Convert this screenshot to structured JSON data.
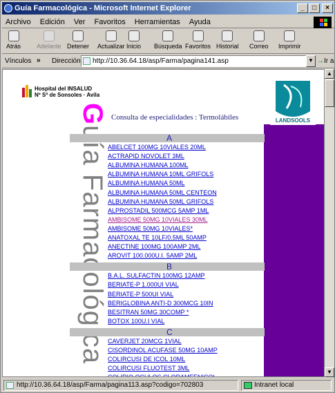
{
  "window": {
    "title": "Guía Farmacológica - Microsoft Internet Explorer",
    "min": "_",
    "max": "□",
    "close": "×"
  },
  "menu": [
    "Archivo",
    "Edición",
    "Ver",
    "Favoritos",
    "Herramientas",
    "Ayuda"
  ],
  "toolbar": [
    {
      "label": "Atrás",
      "icon": "back-arrow-icon",
      "disabled": false
    },
    {
      "label": "Adelante",
      "icon": "forward-arrow-icon",
      "disabled": true
    },
    {
      "label": "Detener",
      "icon": "stop-icon",
      "disabled": false
    },
    {
      "label": "Actualizar",
      "icon": "refresh-icon",
      "disabled": false
    },
    {
      "label": "Inicio",
      "icon": "home-icon",
      "disabled": false
    },
    {
      "label": "Búsqueda",
      "icon": "search-icon",
      "disabled": false
    },
    {
      "label": "Favoritos",
      "icon": "favorites-icon",
      "disabled": false
    },
    {
      "label": "Historial",
      "icon": "history-icon",
      "disabled": false
    },
    {
      "label": "Correo",
      "icon": "mail-icon",
      "disabled": false
    },
    {
      "label": "Imprimir",
      "icon": "print-icon",
      "disabled": false
    }
  ],
  "address": {
    "links_label": "Vínculos",
    "links_chevron": "»",
    "label": "Dirección",
    "url": "http://10.36.64.18/asp/Farma/pagina141.asp",
    "go_label": "Ir a"
  },
  "page": {
    "hospital_line1": "Hospital del INSALUD",
    "hospital_line2": "Nº Sª de Sonsoles · Avila",
    "heading": "Consulta de especialidades : Termolábiles",
    "vertical_title": "Guía Farmacológica",
    "brand": "LANDSOOLS",
    "groups": [
      {
        "letter": "A",
        "items": [
          "ABELCET 100MG 10VIALES 20ML",
          "ACTRAPID NOVOLET 3ML",
          "ALBUMINA HUMANA 100ML",
          "ALBUMINA HUMANA 10ML GRIFOLS",
          "ALBUMINA HUMANA 50ML",
          "ALBUMINA HUMANA 50ML CENTEON",
          "ALBUMINA HUMANA 50ML GRIFOLS",
          "ALPROSTADIL 500MCG 5AMP 1ML",
          "AMBISOME 50MG 10VIALES 30ML",
          "AMBISOME 50MG 10VIALES*",
          "ANATOXAL TE 10LF/0.5ML 50AMP",
          "ANECTINE 100MG 100AMP 2ML",
          "AROVIT 100.000U.I. 5AMP 2ML"
        ]
      },
      {
        "letter": "B",
        "items": [
          "B.A.L. SULFACTIN 100MG 12AMP",
          "BERIATE-P 1.000UI VIAL",
          "BERIATE-P 500UI VIAL",
          "BERIGLOBINA ANTI-D 300MCG 10IN",
          "BESITRAN 50MG 30COMP *",
          "BOTOX 100U.I VIAL"
        ]
      },
      {
        "letter": "C",
        "items": [
          "CAVERJET 20MCG 1VIAL",
          "CISORDINOL ACUFASE 50MG 10AMP",
          "COLIRCUSI DE ICOL 10ML",
          "COLIRCUSI FLUOTEST 3ML",
          "COLIRIO OCULOS CLORAMFENICOL"
        ]
      }
    ],
    "visited_item": "AMBISOME 50MG 10VIALES 30ML"
  },
  "status": {
    "url": "http://10.36.64.18/asp/Farma/pagina113.asp?codigo=702803",
    "zone": "Intranet local"
  },
  "colors": {
    "link": "#0000cc",
    "visited": "#a0208f",
    "sidebar": "#660099",
    "accent": "#ff00ff",
    "letter_bar": "#c0c0c0"
  }
}
